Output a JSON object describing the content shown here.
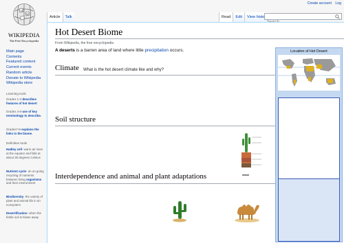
{
  "logo": {
    "wordmark": "WIKIPEDIA",
    "tagline": "The Free Encyclopedia"
  },
  "personal": {
    "create_account": "Create account",
    "login": "Log"
  },
  "tabs_left": [
    "Article",
    "Talk"
  ],
  "tabs_right": [
    "Read",
    "Edit",
    "View history"
  ],
  "search": {
    "placeholder": "Search"
  },
  "nav": [
    "Main page",
    "Contents",
    "Featured content",
    "Current events",
    "Random article",
    "Donate to Wikipedia",
    "Wikipedia store"
  ],
  "learning": {
    "heading": "Learning tools",
    "g13_prefix": "Grades 1-3-",
    "g13_link": "describes features of hot desert",
    "g46_prefix": "Grades 4-6-",
    "g46_link": "use of key terminology to describe.",
    "g7_prefix": "Grades7-8-",
    "g7_link": "explains the links in the biome."
  },
  "definitions": {
    "heading": "Definition tools",
    "hadley_term": "Hadley cell",
    "hadley_text": "- warm air rises at the equator and falls at about 30 degrees Celsius",
    "nutrient_term": "Nutrient cycle",
    "nutrient_text1": "- an on going recycling of nutrients between living",
    "nutrient_term2": "organisms",
    "nutrient_text2": "and their environment",
    "bio_term": "Biodiversity",
    "bio_text": "- the variety of plant and animal life in an ecosystem",
    "desert_term": "Desertification",
    "desert_text": "- when the fertile soil is blown away"
  },
  "article": {
    "title": "Hot Desert Biome",
    "from": "From Wikipedia, the free encyclopedia",
    "intro_bold": "A deserts",
    "intro_text": " is a barren area of land where little ",
    "intro_link": "precipitation",
    "intro_end": " occurs.",
    "h_climate": "Climate",
    "climate_q": "What is the hot desert climate like and why?",
    "h_soil": "Soil structure",
    "h_inter": "Interdependence and animal and plant adaptations"
  },
  "infobox": {
    "title": "Location of Hot Desert"
  },
  "colors": {
    "link": "#0645ad",
    "infobox_bg": "#c4d9f1",
    "infobox_border": "#3757b5"
  }
}
